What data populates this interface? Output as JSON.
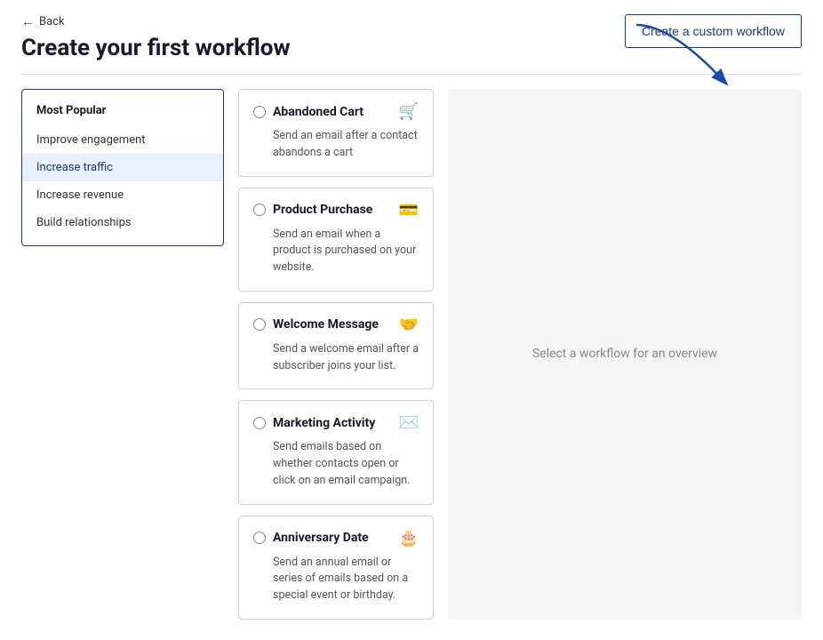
{
  "nav": {
    "back_label": "Back"
  },
  "header": {
    "title": "Create your first workflow",
    "create_button_label": "Create a custom workflow"
  },
  "sidebar": {
    "section_title": "Most Popular",
    "items": [
      {
        "label": "Improve engagement",
        "id": "improve-engagement"
      },
      {
        "label": "Increase traffic",
        "id": "increase-traffic"
      },
      {
        "label": "Increase revenue",
        "id": "increase-revenue"
      },
      {
        "label": "Build relationships",
        "id": "build-relationships"
      }
    ]
  },
  "workflows": [
    {
      "id": "abandoned-cart",
      "title": "Abandoned Cart",
      "description": "Send an email after a contact abandons a cart",
      "icon": "🛒"
    },
    {
      "id": "product-purchase",
      "title": "Product Purchase",
      "description": "Send an email when a product is purchased on your website.",
      "icon": "💳"
    },
    {
      "id": "welcome-message",
      "title": "Welcome Message",
      "description": "Send a welcome email after a subscriber joins your list.",
      "icon": "🤝"
    },
    {
      "id": "marketing-activity",
      "title": "Marketing Activity",
      "description": "Send emails based on whether contacts open or click on an email campaign.",
      "icon": "✉️"
    },
    {
      "id": "anniversary-date",
      "title": "Anniversary Date",
      "description": "Send an annual email or series of emails based on a special event or birthday.",
      "icon": "🎂"
    }
  ],
  "preview": {
    "placeholder": "Select a workflow for an overview"
  }
}
